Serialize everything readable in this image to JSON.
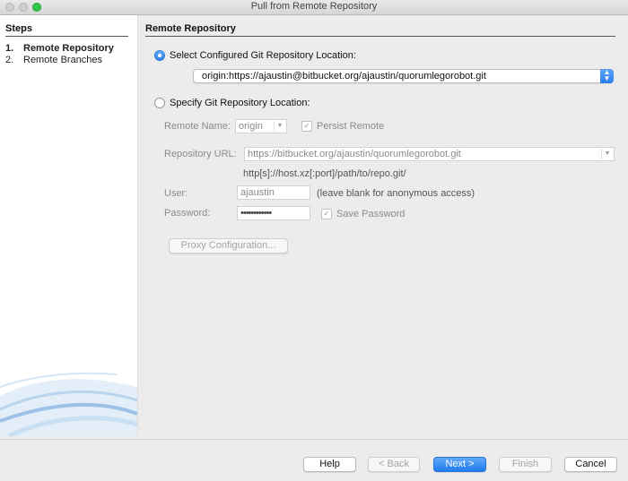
{
  "window": {
    "title": "Pull from Remote Repository"
  },
  "steps": {
    "header": "Steps",
    "items": [
      {
        "num": "1.",
        "label": "Remote Repository"
      },
      {
        "num": "2.",
        "label": "Remote Branches"
      }
    ]
  },
  "panel": {
    "header": "Remote Repository",
    "configured": {
      "label": "Select Configured Git Repository Location:",
      "selected": true,
      "value": "origin:https://ajaustin@bitbucket.org/ajaustin/quorumlegorobot.git"
    },
    "specify": {
      "label": "Specify Git Repository Location:",
      "selected": false,
      "remote_name_label": "Remote Name:",
      "remote_name_value": "origin",
      "persist_remote_label": "Persist Remote",
      "repo_url_label": "Repository URL:",
      "repo_url_value": "https://bitbucket.org/ajaustin/quorumlegorobot.git",
      "url_hint": "http[s]://host.xz[:port]/path/to/repo.git/",
      "user_label": "User:",
      "user_value": "ajaustin",
      "user_hint": "(leave blank for anonymous access)",
      "password_label": "Password:",
      "password_value": "••••••••••••",
      "save_password_label": "Save Password",
      "proxy_button": "Proxy Configuration..."
    }
  },
  "buttons": {
    "help": "Help",
    "back": "< Back",
    "next": "Next >",
    "finish": "Finish",
    "cancel": "Cancel"
  },
  "colors": {
    "accent": "#2a7ff0",
    "disabled_text": "#8a8a8a"
  }
}
